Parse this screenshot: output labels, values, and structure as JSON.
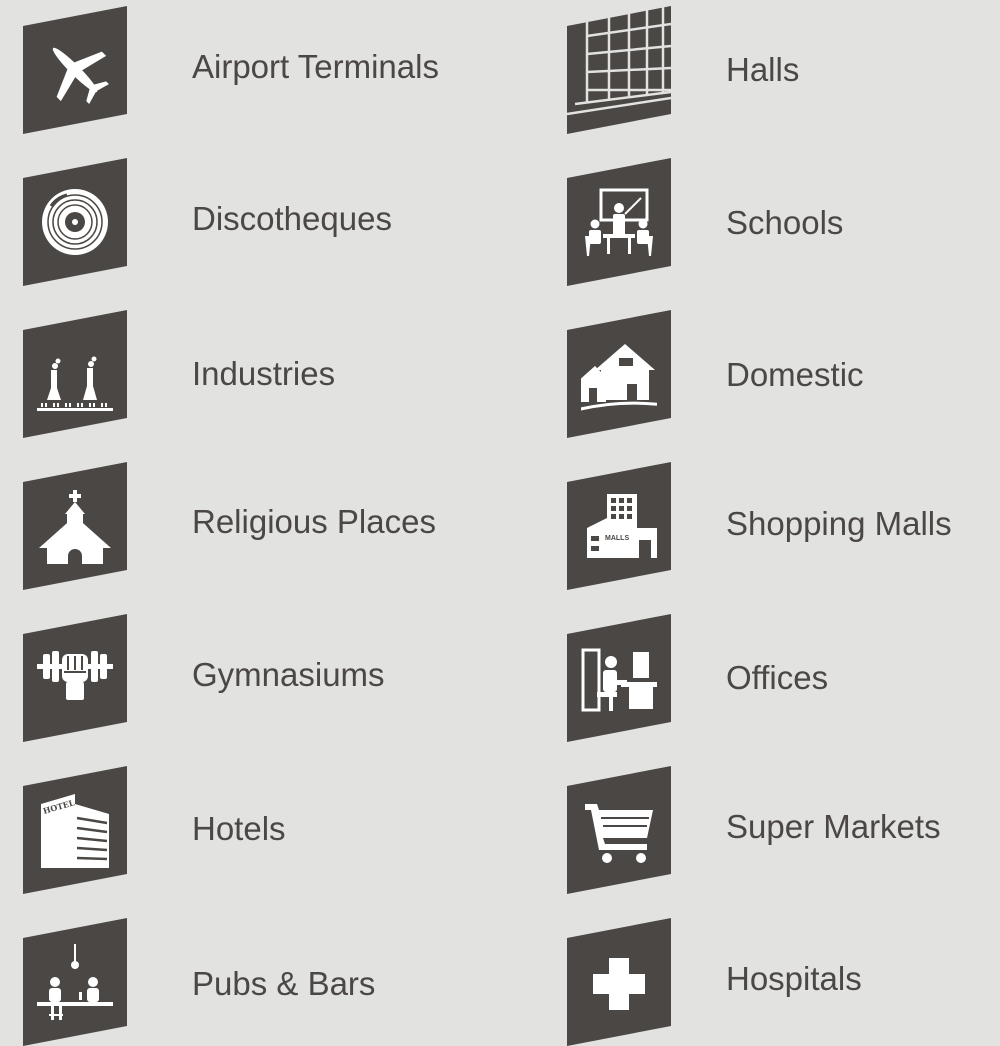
{
  "colors": {
    "background": "#e2e2e0",
    "tile": "#4b4744",
    "icon": "#ffffff",
    "text": "#4b4744"
  },
  "left_column": [
    {
      "label": "Airport Terminals",
      "icon": "airplane-icon"
    },
    {
      "label": "Discotheques",
      "icon": "vinyl-record-icon"
    },
    {
      "label": "Industries",
      "icon": "factory-icon"
    },
    {
      "label": "Religious Places",
      "icon": "chapel-icon"
    },
    {
      "label": "Gymnasiums",
      "icon": "dumbbell-fist-icon"
    },
    {
      "label": "Hotels",
      "icon": "hotel-building-icon"
    },
    {
      "label": "Pubs & Bars",
      "icon": "bar-counter-icon"
    }
  ],
  "right_column": [
    {
      "label": "Halls",
      "icon": "hall-grid-icon"
    },
    {
      "label": "Schools",
      "icon": "classroom-icon"
    },
    {
      "label": "Domestic",
      "icon": "houses-icon"
    },
    {
      "label": "Shopping Malls",
      "icon": "mall-building-icon",
      "sign_text": "MALLS"
    },
    {
      "label": "Offices",
      "icon": "office-worker-icon"
    },
    {
      "label": "Super Markets",
      "icon": "shopping-cart-icon"
    },
    {
      "label": "Hospitals",
      "icon": "medical-cross-icon"
    }
  ],
  "hotel_sign_text": "HOTEL"
}
